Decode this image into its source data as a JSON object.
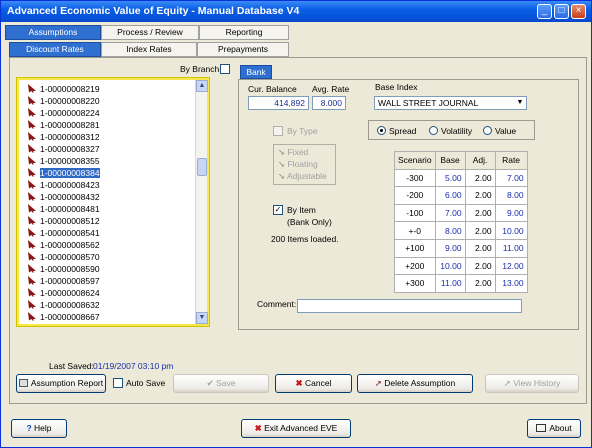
{
  "window": {
    "title": "Advanced Economic Value of Equity - Manual Database V4"
  },
  "tabs_top": [
    {
      "label": "Assumptions"
    },
    {
      "label": "Process / Review"
    },
    {
      "label": "Reporting"
    }
  ],
  "tabs_sub": [
    {
      "label": "Discount Rates"
    },
    {
      "label": "Index Rates"
    },
    {
      "label": "Prepayments"
    }
  ],
  "by_branch": {
    "label": "By Branch"
  },
  "bank_tab": {
    "label": "Bank"
  },
  "accounts": [
    "1-00000008219",
    "1-00000008220",
    "1-00000008224",
    "1-00000008281",
    "1-00000008312",
    "1-00000008327",
    "1-00000008355",
    "1-00000008384",
    "1-00000008423",
    "1-00000008432",
    "1-00000008481",
    "1-00000008512",
    "1-00000008541",
    "1-00000008562",
    "1-00000008570",
    "1-00000008590",
    "1-00000008597",
    "1-00000008624",
    "1-00000008632",
    "1-00000008667"
  ],
  "selected_account": "1-00000008384",
  "cur_balance": {
    "label": "Cur. Balance",
    "value": "414,892"
  },
  "avg_rate": {
    "label": "Avg. Rate",
    "value": "8.000"
  },
  "base_index": {
    "label": "Base Index",
    "value": "WALL STREET JOURNAL"
  },
  "by_type": {
    "label": "By Type"
  },
  "types": [
    "Fixed",
    "Floating",
    "Adjustable"
  ],
  "by_item": {
    "label_line1": "By Item",
    "label_line2": "(Bank Only)",
    "checked": true
  },
  "items_loaded": "200 Items loaded.",
  "radio": {
    "spread": "Spread",
    "volatility": "Volatility",
    "value": "Value",
    "selected": "spread"
  },
  "scenario_table": {
    "headers": [
      "Scenario",
      "Base",
      "Adj.",
      "Rate"
    ],
    "rows": [
      [
        "-300",
        "5.00",
        "2.00",
        "7.00"
      ],
      [
        "-200",
        "6.00",
        "2.00",
        "8.00"
      ],
      [
        "-100",
        "7.00",
        "2.00",
        "9.00"
      ],
      [
        "+-0",
        "8.00",
        "2.00",
        "10.00"
      ],
      [
        "+100",
        "9.00",
        "2.00",
        "11.00"
      ],
      [
        "+200",
        "10.00",
        "2.00",
        "12.00"
      ],
      [
        "+300",
        "11.00",
        "2.00",
        "13.00"
      ]
    ]
  },
  "comment": {
    "label": "Comment:",
    "value": ""
  },
  "last_saved": {
    "label": "Last Saved:",
    "value": "01/19/2007 03:10 pm"
  },
  "buttons": {
    "assumption_report": "Assumption Report",
    "auto_save": "Auto Save",
    "save": "Save",
    "cancel": "Cancel",
    "delete": "Delete Assumption",
    "view_history": "View History",
    "help": "Help",
    "exit": "Exit Advanced EVE",
    "about": "About"
  },
  "colors": {
    "accent": "#2f6fd0",
    "title": "#0553d9",
    "value_text": "#1a2ea8",
    "selection": "#316ac5"
  }
}
